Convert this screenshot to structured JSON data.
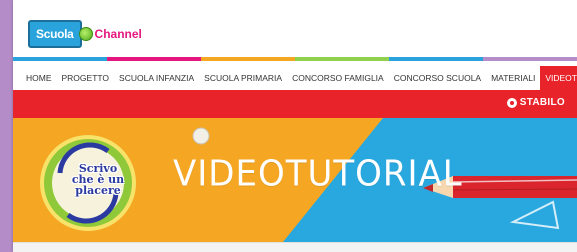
{
  "logo": {
    "part1": "Scuola",
    "part2": "Channel"
  },
  "stripe_colors": [
    "#2aa3dc",
    "#e5177e",
    "#f5a623",
    "#8fd14f",
    "#2aa3dc",
    "#b48cc8"
  ],
  "nav": {
    "items": [
      {
        "label": "HOME"
      },
      {
        "label": "PROGETTO"
      },
      {
        "label": "SCUOLA INFANZIA"
      },
      {
        "label": "SCUOLA PRIMARIA"
      },
      {
        "label": "CONCORSO FAMIGLIA"
      },
      {
        "label": "CONCORSO SCUOLA"
      },
      {
        "label": "MATERIALI"
      },
      {
        "label": "VIDEOTUTORIAL",
        "active": true
      }
    ]
  },
  "brand": {
    "name": "STABILO"
  },
  "banner": {
    "title": "VIDEOTUTORIAL",
    "badge_lines": [
      "Scrivo",
      "che è un",
      "placere"
    ]
  },
  "colors": {
    "accent_red": "#e8232a",
    "banner_orange": "#f5a623",
    "banner_blue": "#29a8e0"
  }
}
